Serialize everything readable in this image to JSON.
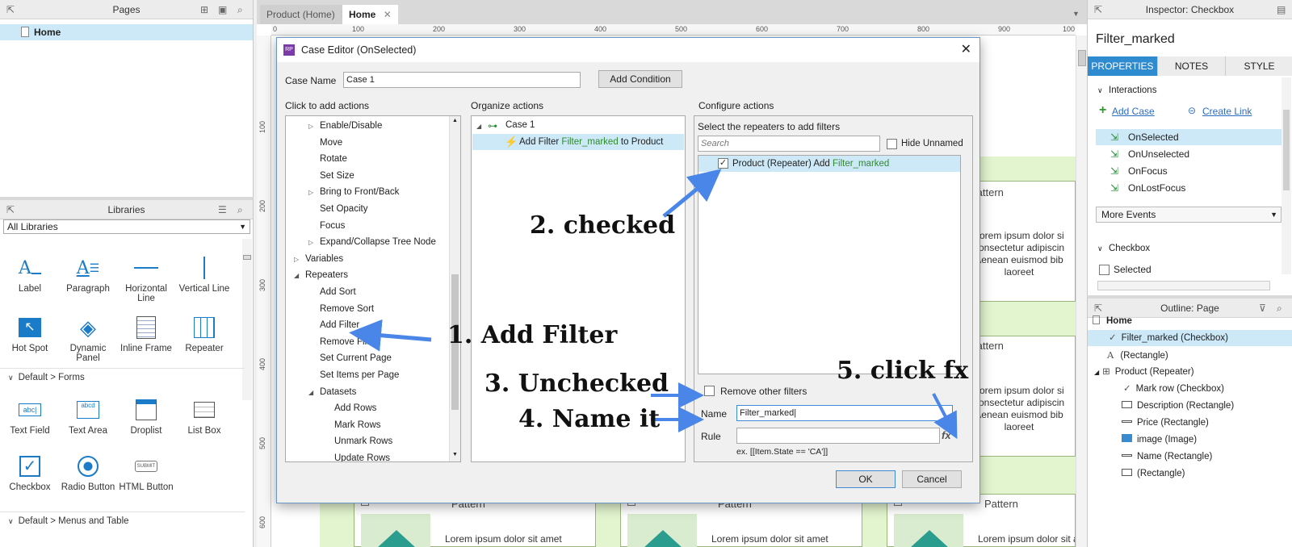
{
  "pages_panel": {
    "title": "Pages",
    "items": [
      {
        "label": "Home"
      }
    ]
  },
  "libraries_panel": {
    "title": "Libraries",
    "dropdown": "All Libraries",
    "widgets": [
      {
        "label": "Label",
        "icon": "label-icon"
      },
      {
        "label": "Paragraph",
        "icon": "paragraph-icon"
      },
      {
        "label": "Horizontal Line",
        "icon": "horizontal-line-icon"
      },
      {
        "label": "Vertical Line",
        "icon": "vertical-line-icon"
      },
      {
        "label": "Hot Spot",
        "icon": "hot-spot-icon"
      },
      {
        "label": "Dynamic Panel",
        "icon": "dynamic-panel-icon"
      },
      {
        "label": "Inline Frame",
        "icon": "inline-frame-icon"
      },
      {
        "label": "Repeater",
        "icon": "repeater-icon"
      }
    ],
    "section_forms": "Default > Forms",
    "forms_widgets": [
      {
        "label": "Text Field",
        "icon": "text-field-icon"
      },
      {
        "label": "Text Area",
        "icon": "text-area-icon"
      },
      {
        "label": "Droplist",
        "icon": "droplist-icon"
      },
      {
        "label": "List Box",
        "icon": "list-box-icon"
      },
      {
        "label": "Checkbox",
        "icon": "checkbox-icon"
      },
      {
        "label": "Radio Button",
        "icon": "radio-button-icon"
      },
      {
        "label": "HTML Button",
        "icon": "html-button-icon"
      }
    ],
    "section_menus": "Default > Menus and Table"
  },
  "canvas": {
    "tabs": [
      {
        "label": "Product (Home)"
      },
      {
        "label": "Home"
      }
    ],
    "ruler_h": [
      "0",
      "100",
      "200",
      "300",
      "400",
      "500",
      "600",
      "700",
      "800",
      "900",
      "100"
    ],
    "ruler_v": [
      "100",
      "200",
      "300",
      "400",
      "500",
      "600"
    ],
    "pattern": "Pattern",
    "lorem_lines": [
      "Lorem ipsum dolor si",
      "consectetur adipiscin",
      "Aenean euismod bib",
      "laoreet"
    ],
    "lorem_bottom": "Lorem ipsum dolor sit amet"
  },
  "dialog": {
    "title": "Case Editor (OnSelected)",
    "case_name_label": "Case Name",
    "case_name_value": "Case 1",
    "add_condition": "Add Condition",
    "col1_title": "Click to add actions",
    "col2_title": "Organize actions",
    "col3_title": "Configure actions",
    "actions": [
      {
        "label": "Enable/Disable",
        "expander": "▷"
      },
      {
        "label": "Move"
      },
      {
        "label": "Rotate"
      },
      {
        "label": "Set Size"
      },
      {
        "label": "Bring to Front/Back",
        "expander": "▷"
      },
      {
        "label": "Set Opacity"
      },
      {
        "label": "Focus"
      },
      {
        "label": "Expand/Collapse Tree Node",
        "expander": "▷"
      },
      {
        "label": "Variables",
        "expander": "▷"
      },
      {
        "label": "Repeaters",
        "expander": "◢"
      },
      {
        "label": "Add Sort"
      },
      {
        "label": "Remove Sort"
      },
      {
        "label": "Add Filter"
      },
      {
        "label": "Remove Filter"
      },
      {
        "label": "Set Current Page"
      },
      {
        "label": "Set Items per Page"
      },
      {
        "label": "Datasets",
        "expander": "◢"
      },
      {
        "label": "Add Rows"
      },
      {
        "label": "Mark Rows"
      },
      {
        "label": "Unmark Rows"
      },
      {
        "label": "Update Rows"
      }
    ],
    "organize": {
      "case_label": "Case 1",
      "action_prefix": "Add Filter ",
      "action_target": "Filter_marked",
      "action_suffix": " to Product"
    },
    "configure": {
      "heading": "Select the repeaters to add filters",
      "search_placeholder": "Search",
      "hide_unnamed": "Hide Unnamed",
      "repeater_prefix": "Product (Repeater) Add ",
      "repeater_filter": "Filter_marked",
      "remove_other_filters": "Remove other filters",
      "name_label": "Name",
      "name_value": "Filter_marked",
      "rule_label": "Rule",
      "fx_label": "fx",
      "example": "ex. [[Item.State == 'CA']]"
    },
    "ok": "OK",
    "cancel": "Cancel"
  },
  "annotations": {
    "a1": "1. Add Filter",
    "a2": "2. checked",
    "a3": "3. Unchecked",
    "a4": "4. Name it",
    "a5": "5. click fx"
  },
  "inspector": {
    "title": "Inspector: Checkbox",
    "widget_name": "Filter_marked",
    "tabs": [
      "PROPERTIES",
      "NOTES",
      "STYLE"
    ],
    "interactions_label": "Interactions",
    "add_case": "Add Case",
    "create_link": "Create Link",
    "events": [
      "OnSelected",
      "OnUnselected",
      "OnFocus",
      "OnLostFocus"
    ],
    "more_events": "More Events",
    "checkbox_section": "Checkbox",
    "selected_label": "Selected"
  },
  "outline": {
    "title": "Outline: Page",
    "items": [
      {
        "label": "Home"
      },
      {
        "label": "Filter_marked (Checkbox)"
      },
      {
        "label": "(Rectangle)"
      },
      {
        "label": "Product (Repeater)"
      },
      {
        "label": "Mark row (Checkbox)"
      },
      {
        "label": "Description (Rectangle)"
      },
      {
        "label": "Price (Rectangle)"
      },
      {
        "label": "image (Image)"
      },
      {
        "label": "Name (Rectangle)"
      },
      {
        "label": "(Rectangle)"
      }
    ]
  },
  "colors": {
    "accent": "#2e8bd0",
    "selection": "#cde8f6",
    "arrow": "#4a86e8",
    "green_text": "#2e8b2e",
    "canvas_green": "#e3f5cf"
  }
}
